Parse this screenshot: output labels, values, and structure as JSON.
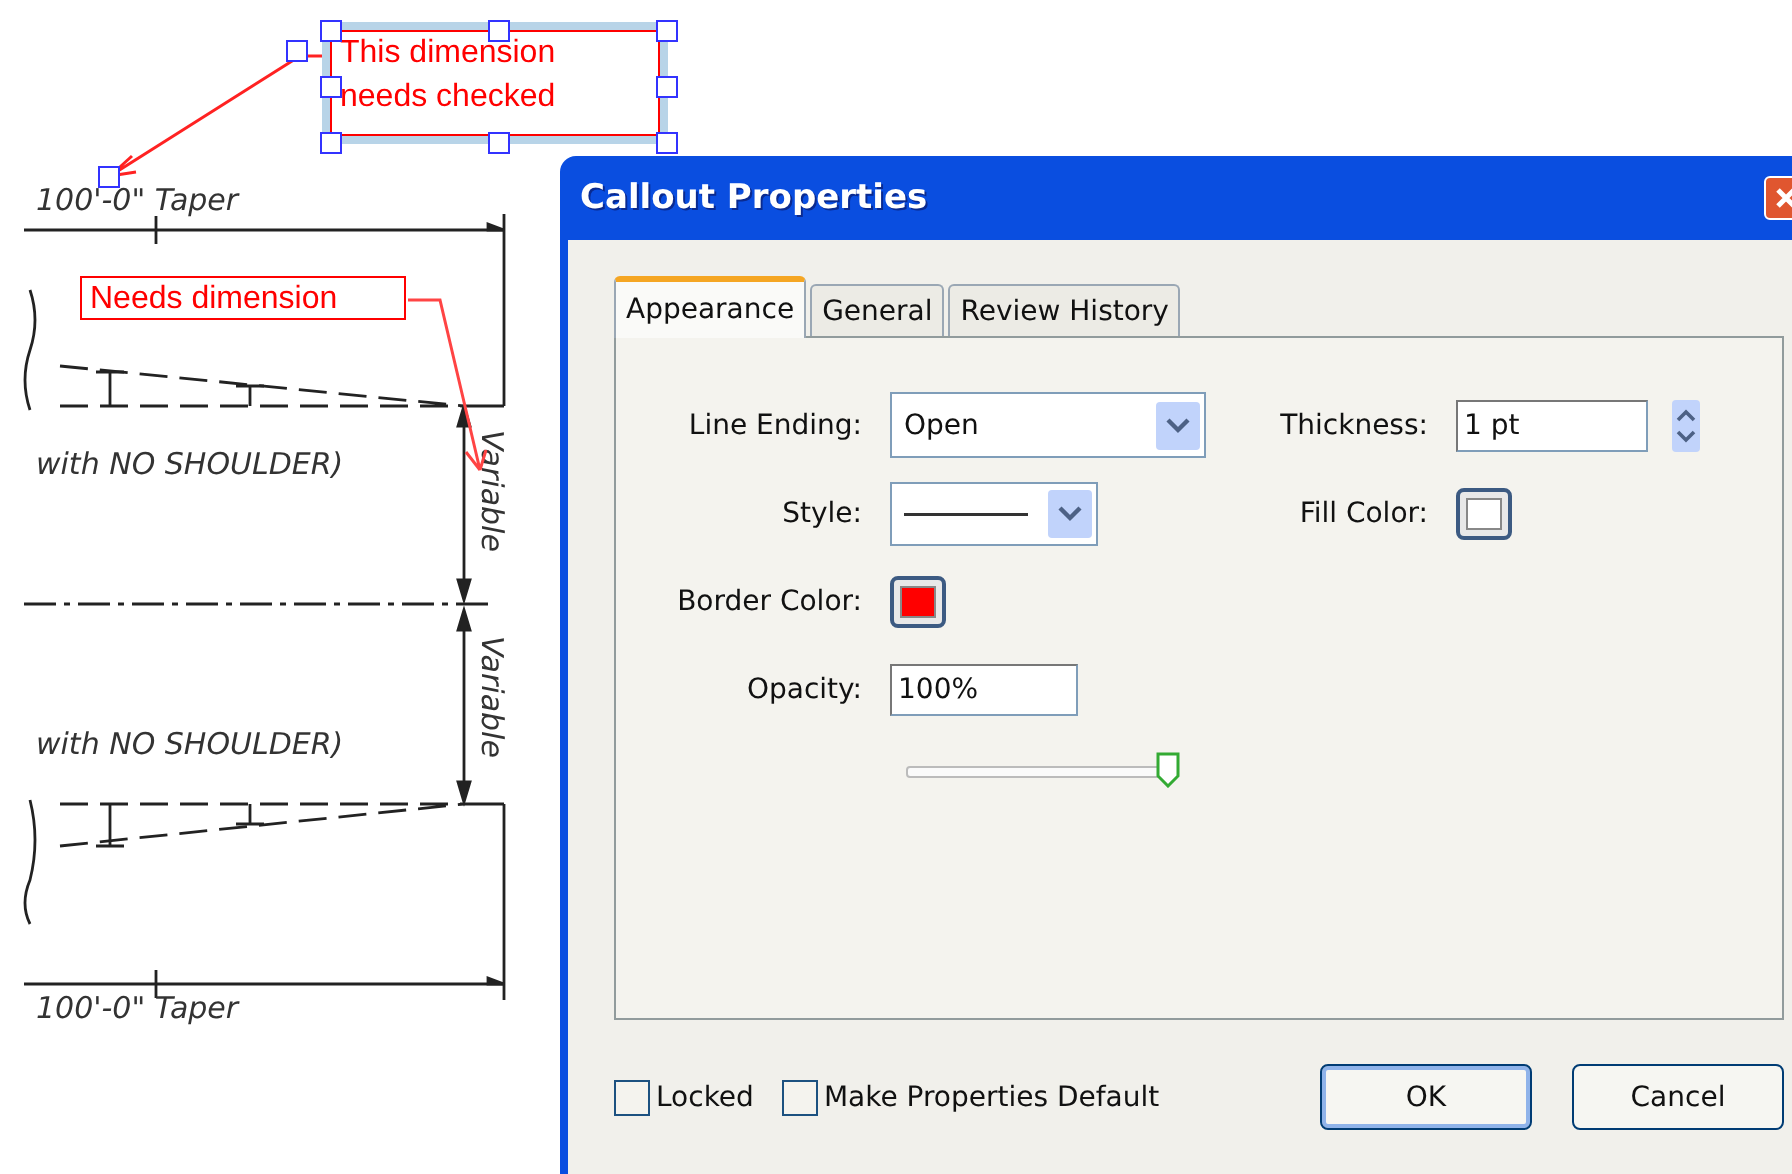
{
  "drawing": {
    "callouts": [
      {
        "text": "This dimension needs checked",
        "selected": true
      },
      {
        "text": "Needs dimension",
        "selected": false
      }
    ],
    "labels": [
      {
        "kind": "horizontal",
        "text": "100'-0\" Taper"
      },
      {
        "kind": "horizontal",
        "text": "with NO SHOULDER)"
      },
      {
        "kind": "vertical",
        "text": "Variable"
      },
      {
        "kind": "vertical",
        "text": "Variable"
      },
      {
        "kind": "horizontal",
        "text": "with NO SHOULDER)"
      },
      {
        "kind": "horizontal",
        "text": "100'-0\" Taper"
      }
    ]
  },
  "window": {
    "title": "Callout Properties"
  },
  "tabs": [
    {
      "label": "Appearance",
      "selected": true
    },
    {
      "label": "General",
      "selected": false
    },
    {
      "label": "Review History",
      "selected": false
    }
  ],
  "fields": {
    "line_ending": {
      "label": "Line Ending:",
      "value": "Open"
    },
    "thickness": {
      "label": "Thickness:",
      "value": "1 pt"
    },
    "style": {
      "label": "Style:"
    },
    "fill_color": {
      "label": "Fill Color:",
      "color": "#ffffff"
    },
    "border_color": {
      "label": "Border Color:",
      "color": "#ff0000"
    },
    "opacity": {
      "label": "Opacity:",
      "value": "100%",
      "level": 1
    }
  },
  "checkboxes": [
    {
      "label": "Locked",
      "checked": false
    },
    {
      "label": "Make Properties Default",
      "checked": false
    }
  ],
  "buttons": [
    {
      "label": "OK",
      "default": true
    },
    {
      "label": "Cancel",
      "default": false
    }
  ]
}
